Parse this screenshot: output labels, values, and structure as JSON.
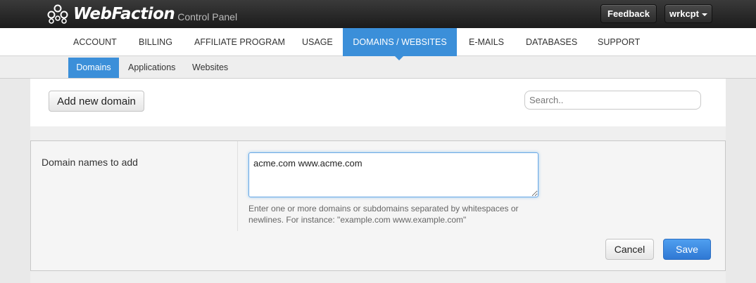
{
  "header": {
    "brand": "WebFaction",
    "brand_sub": "Control Panel",
    "feedback_label": "Feedback",
    "user_label": "wrkcpt"
  },
  "main_nav": {
    "items": [
      {
        "label": "ACCOUNT"
      },
      {
        "label": "BILLING"
      },
      {
        "label": "AFFILIATE PROGRAM"
      },
      {
        "label": "USAGE"
      },
      {
        "label": "DOMAINS / WEBSITES",
        "active": true
      },
      {
        "label": "E-MAILS"
      },
      {
        "label": "DATABASES"
      },
      {
        "label": "SUPPORT"
      }
    ]
  },
  "sub_nav": {
    "items": [
      {
        "label": "Domains",
        "active": true
      },
      {
        "label": "Applications"
      },
      {
        "label": "Websites"
      }
    ]
  },
  "toolbar": {
    "add_label": "Add new domain",
    "search_placeholder": "Search.."
  },
  "form": {
    "field_label": "Domain names to add",
    "field_value": "acme.com www.acme.com",
    "help_text": "Enter one or more domains or subdomains separated by whitespaces or newlines. For instance: \"example.com www.example.com\"",
    "cancel_label": "Cancel",
    "save_label": "Save"
  },
  "colors": {
    "accent": "#3b8fd9",
    "topbar": "#222222"
  }
}
